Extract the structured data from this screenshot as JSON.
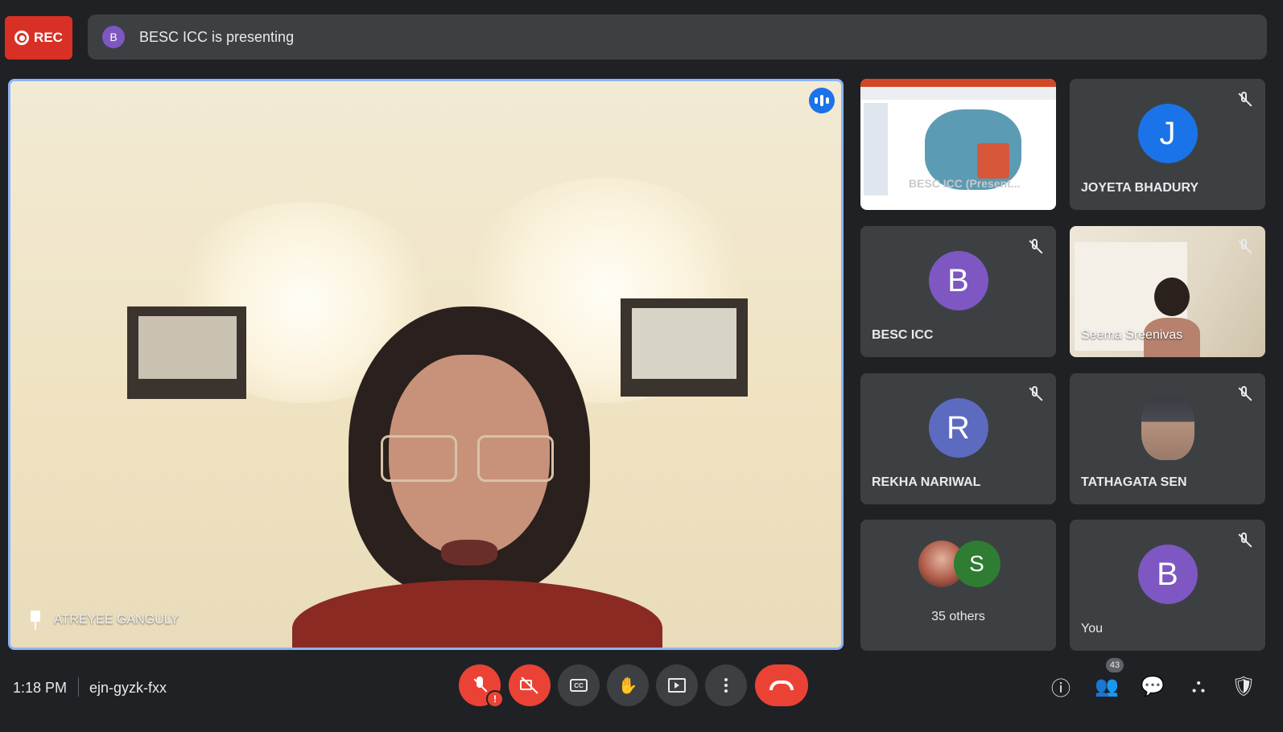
{
  "recording": {
    "label": "REC"
  },
  "presenting_banner": {
    "avatar_letter": "B",
    "text": "BESC ICC is presenting"
  },
  "main_tile": {
    "participant_name": "ATREYEE GANGULY"
  },
  "participants": [
    {
      "name": "BESC ICC (Presentation)",
      "caption": "BESC ICC (Present..."
    },
    {
      "name": "JOYETA BHADURY",
      "avatar_letter": "J",
      "avatar_color": "#1a73e8"
    },
    {
      "name": "BESC ICC",
      "avatar_letter": "B",
      "avatar_color": "#7e57c2"
    },
    {
      "name": "Seema Sreenivas"
    },
    {
      "name": "REKHA NARIWAL",
      "avatar_letter": "R",
      "avatar_color": "#5c6bc0"
    },
    {
      "name": "TATHAGATA SEN"
    },
    {
      "others_label": "35 others",
      "avatar_letter": "S",
      "avatar_color": "#2e7d32"
    },
    {
      "name": "You",
      "avatar_letter": "B",
      "avatar_color": "#7e57c2"
    }
  ],
  "bottom": {
    "time": "1:18 PM",
    "meeting_code": "ejn-gyzk-fxx",
    "participant_count": "43",
    "cc_label": "CC",
    "mic_warning": "!"
  },
  "icons": {
    "info": "info-icon",
    "people": "people-icon",
    "chat": "chat-icon",
    "activities": "activities-icon",
    "host_controls": "shield-icon"
  }
}
